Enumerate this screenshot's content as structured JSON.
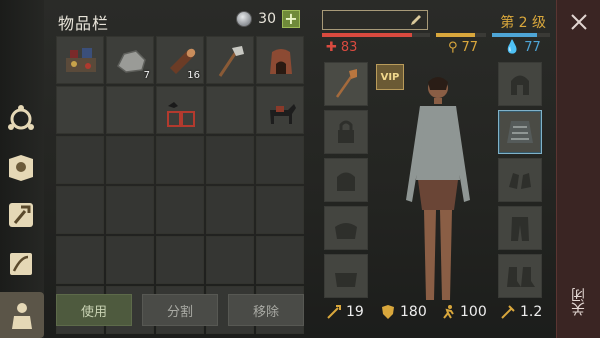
{
  "nav": {
    "items": [
      {
        "name": "nav-skills",
        "icon": "settings-circle-icon"
      },
      {
        "name": "nav-journal",
        "icon": "sun-book-icon"
      },
      {
        "name": "nav-crafting",
        "icon": "hammer-axe-icon"
      },
      {
        "name": "nav-quests",
        "icon": "scroll-quill-icon"
      },
      {
        "name": "nav-character",
        "icon": "character-icon",
        "active": true
      }
    ]
  },
  "inventory": {
    "title": "物品栏",
    "currency": "30",
    "add": "+",
    "items": [
      {
        "name": "workbench",
        "icon": "workbench-icon",
        "qty": ""
      },
      {
        "name": "stone",
        "icon": "stone-icon",
        "qty": "7"
      },
      {
        "name": "log",
        "icon": "log-icon",
        "qty": "16"
      },
      {
        "name": "axe",
        "icon": "axe-icon",
        "qty": ""
      },
      {
        "name": "furnace",
        "icon": "furnace-icon",
        "qty": ""
      },
      {
        "name": "empty",
        "icon": "",
        "qty": ""
      },
      {
        "name": "empty",
        "icon": "",
        "qty": ""
      },
      {
        "name": "crow-cage",
        "icon": "crow-cage-icon",
        "qty": ""
      },
      {
        "name": "empty",
        "icon": "",
        "qty": ""
      },
      {
        "name": "horse",
        "icon": "horse-icon",
        "qty": ""
      }
    ],
    "actions": {
      "use": "使用",
      "split": "分割",
      "remove": "移除"
    }
  },
  "character": {
    "level": "第 2 级",
    "health": "83",
    "food": "77",
    "water": "77",
    "vip": "VIP",
    "attack": "19",
    "armor": "180",
    "speed": "100",
    "weight": "1.2",
    "health_pct": 0.83,
    "food_pct": 0.77,
    "water_pct": 0.77,
    "colors": {
      "health": "#d94a3f",
      "food": "#d9a73c",
      "water": "#4ea5d6"
    }
  },
  "close": {
    "label": "关闭"
  }
}
